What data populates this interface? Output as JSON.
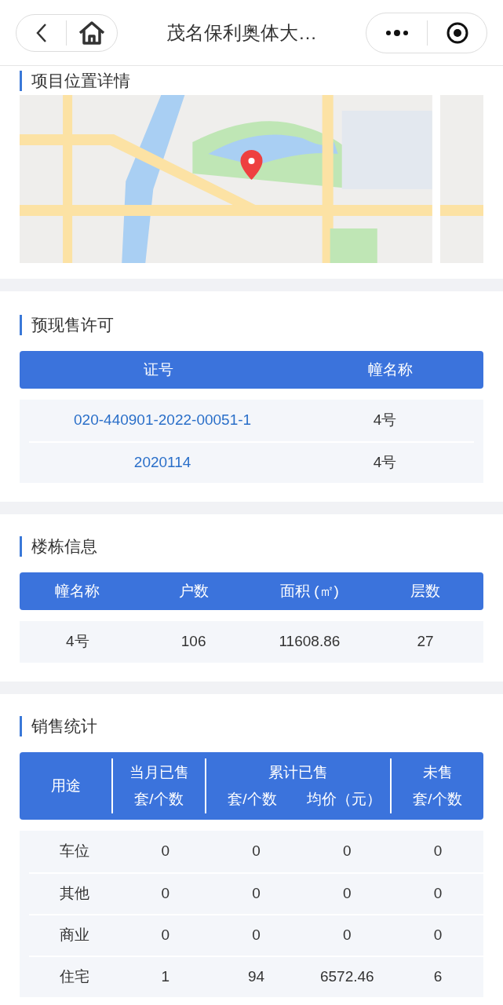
{
  "nav": {
    "title": "茂名保利奥体大…"
  },
  "location": {
    "title": "项目位置详情"
  },
  "permits": {
    "title": "预现售许可",
    "columns": [
      "证号",
      "幢名称"
    ],
    "rows": [
      {
        "number": "020-440901-2022-00051-1",
        "building": "4号"
      },
      {
        "number": "2020114",
        "building": "4号"
      }
    ]
  },
  "buildings": {
    "title": "楼栋信息",
    "columns": [
      "幢名称",
      "户数",
      "面积 (㎡)",
      "层数"
    ],
    "rows": [
      [
        "4号",
        "106",
        "11608.86",
        "27"
      ]
    ]
  },
  "sales": {
    "title": "销售统计",
    "groups": [
      {
        "title": "用途"
      },
      {
        "title": "当月已售",
        "subs": [
          "套/个数"
        ]
      },
      {
        "title": "累计已售",
        "subs": [
          "套/个数",
          "均价（元）"
        ]
      },
      {
        "title": "未售",
        "subs": [
          "套/个数"
        ]
      }
    ],
    "rows": [
      [
        "车位",
        "0",
        "0",
        "0",
        "0"
      ],
      [
        "其他",
        "0",
        "0",
        "0",
        "0"
      ],
      [
        "商业",
        "0",
        "0",
        "0",
        "0"
      ],
      [
        "住宅",
        "1",
        "94",
        "6572.46",
        "6"
      ]
    ]
  }
}
